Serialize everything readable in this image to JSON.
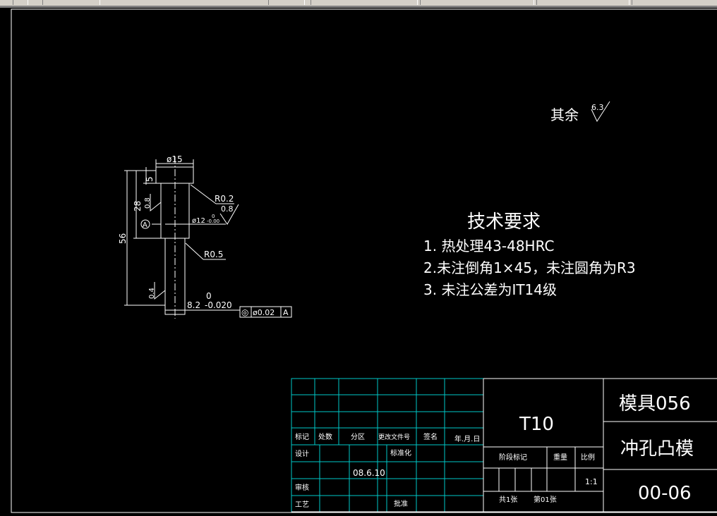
{
  "drawing": {
    "surface_finish_note": {
      "prefix": "其余",
      "value": "6.3"
    },
    "dimensions": {
      "top_diameter": "ø15",
      "head_height": "5",
      "shank_length": "28",
      "total_length": "56",
      "head_radius": "R0.2",
      "body_finish": "0.8",
      "roughness_left_top": "0.8",
      "body_diameter": "ø12",
      "body_diameter_tol": "-0.00",
      "body_diameter_tol_upper": "0",
      "datum": "A",
      "neck_radius": "R0.5",
      "roughness_left_bottom": "0.4",
      "punch_diameter": "8.2",
      "punch_tol_upper": "0",
      "punch_tol_lower": "-0.020",
      "fcf_symbol": "◎",
      "fcf_tolerance": "ø0.02",
      "fcf_datum": "A"
    },
    "tech_requirements": {
      "title": "技术要求",
      "items": [
        "1. 热处理43-48HRC",
        "2.未注倒角1×45，未注圆角为R3",
        "3. 未注公差为IT14级"
      ]
    }
  },
  "title_block": {
    "headers": [
      "标记",
      "处数",
      "分区",
      "更改文件号",
      "签名",
      "年.月.日"
    ],
    "design_label": "设计",
    "standardize_label": "标准化",
    "date": "08.6.10",
    "check_label": "审核",
    "process_label": "工艺",
    "approve_label": "批准",
    "material": "T10",
    "stage_label": "阶段标记",
    "weight_label": "重量",
    "scale_label": "比例",
    "scale": "1:1",
    "sheets_total": "共1张",
    "sheet_no": "第01张",
    "project": "模具056",
    "part_name": "冲孔凸模",
    "drawing_no": "00-06"
  },
  "colors": {
    "background": "#000000",
    "lines": "#ffffff",
    "table_grid": "#00c8c8"
  }
}
